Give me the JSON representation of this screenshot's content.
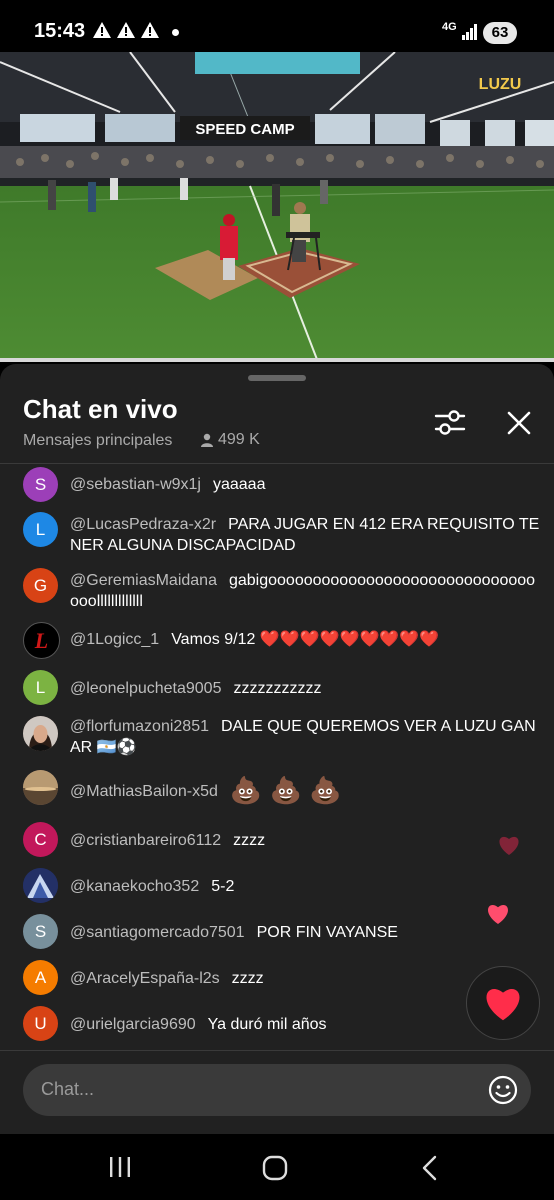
{
  "status": {
    "time": "15:43",
    "network": "4G",
    "battery": "63"
  },
  "video": {
    "banner_text": "SPEED CAMP",
    "brand_text": "LUZU"
  },
  "chat": {
    "title": "Chat en vivo",
    "subtitle": "Mensajes principales",
    "viewers": "499 K",
    "input_placeholder": "Chat..."
  },
  "messages": [
    {
      "letter": "S",
      "color": "#9c3fb8",
      "author": "@sebastian-w9x1j",
      "text": "yaaaaa"
    },
    {
      "letter": "L",
      "color": "#1e88e5",
      "author": "@LucasPedraza-x2r",
      "text": "PARA JUGAR EN 412 ERA REQUISITO TENER ALGUNA DISCAPACIDAD"
    },
    {
      "letter": "G",
      "color": "#d84315",
      "author": "@GeremiasMaidana",
      "text": "gabigooooooooooooooooooooooooooooooooolllllllllllll"
    },
    {
      "letter": "",
      "color": "#000000",
      "author": "@1Logicc_1",
      "text": "Vamos 9/12 ❤️❤️❤️❤️❤️❤️❤️❤️❤️"
    },
    {
      "letter": "L",
      "color": "#7cb342",
      "author": "@leonelpucheta9005",
      "text": "zzzzzzzzzzz"
    },
    {
      "letter": "",
      "color": "#6d4c41",
      "author": "@florfumazoni2851",
      "text": "DALE QUE QUEREMOS VER A LUZU GANAR 🇦🇷⚽"
    },
    {
      "letter": "",
      "color": "#8d6e63",
      "author": "@MathiasBailon-x5d",
      "text": "💩 💩 💩"
    },
    {
      "letter": "C",
      "color": "#c2185b",
      "author": "@cristianbareiro6112",
      "text": "zzzz"
    },
    {
      "letter": "",
      "color": "#3f51b5",
      "author": "@kanaekocho352",
      "text": "5-2"
    },
    {
      "letter": "S",
      "color": "#78909c",
      "author": "@santiagomercado7501",
      "text": "POR FIN VAYANSE"
    },
    {
      "letter": "A",
      "color": "#f57c00",
      "author": "@AracelyEspaña-l2s",
      "text": "zzzz"
    },
    {
      "letter": "U",
      "color": "#d84315",
      "author": "@urielgarcia9690",
      "text": "Ya duró mil años"
    }
  ],
  "icons": {
    "filter": "sliders-icon",
    "close": "close-icon",
    "heart": "heart-icon",
    "emoji": "emoji-icon",
    "nav_recents": "recents-icon",
    "nav_home": "home-icon",
    "nav_back": "back-icon"
  }
}
